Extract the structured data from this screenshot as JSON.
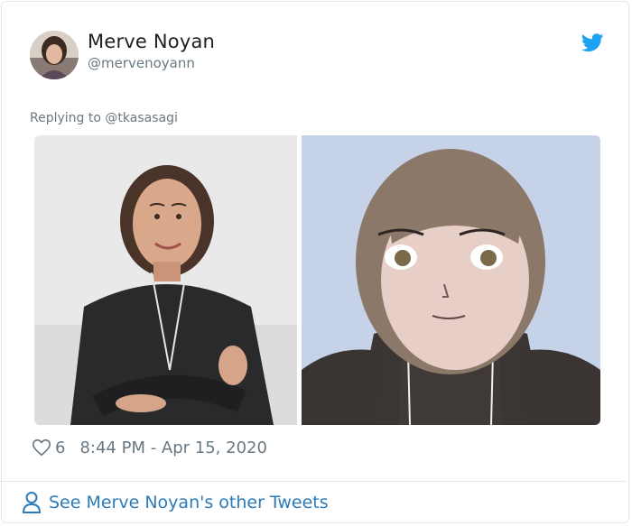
{
  "tweet": {
    "author": {
      "name": "Merve Noyan",
      "handle": "@mervenoyann",
      "avatar_icon": "avatar-photo"
    },
    "brand_icon": "twitter-bird-icon",
    "reply_prefix": "Replying to ",
    "reply_to": "@tkasasagi",
    "media": [
      {
        "icon": "photo-of-woman"
      },
      {
        "icon": "anime-style-portrait"
      }
    ],
    "likes": "6",
    "timestamp": "8:44 PM - Apr 15, 2020"
  },
  "footer": {
    "link_label": "See Merve Noyan's other Tweets",
    "icon": "person-icon"
  },
  "colors": {
    "link": "#2b7bb9",
    "secondary_text": "#697882",
    "twitter_blue": "#1da1f2",
    "border": "#e1e8ed"
  }
}
